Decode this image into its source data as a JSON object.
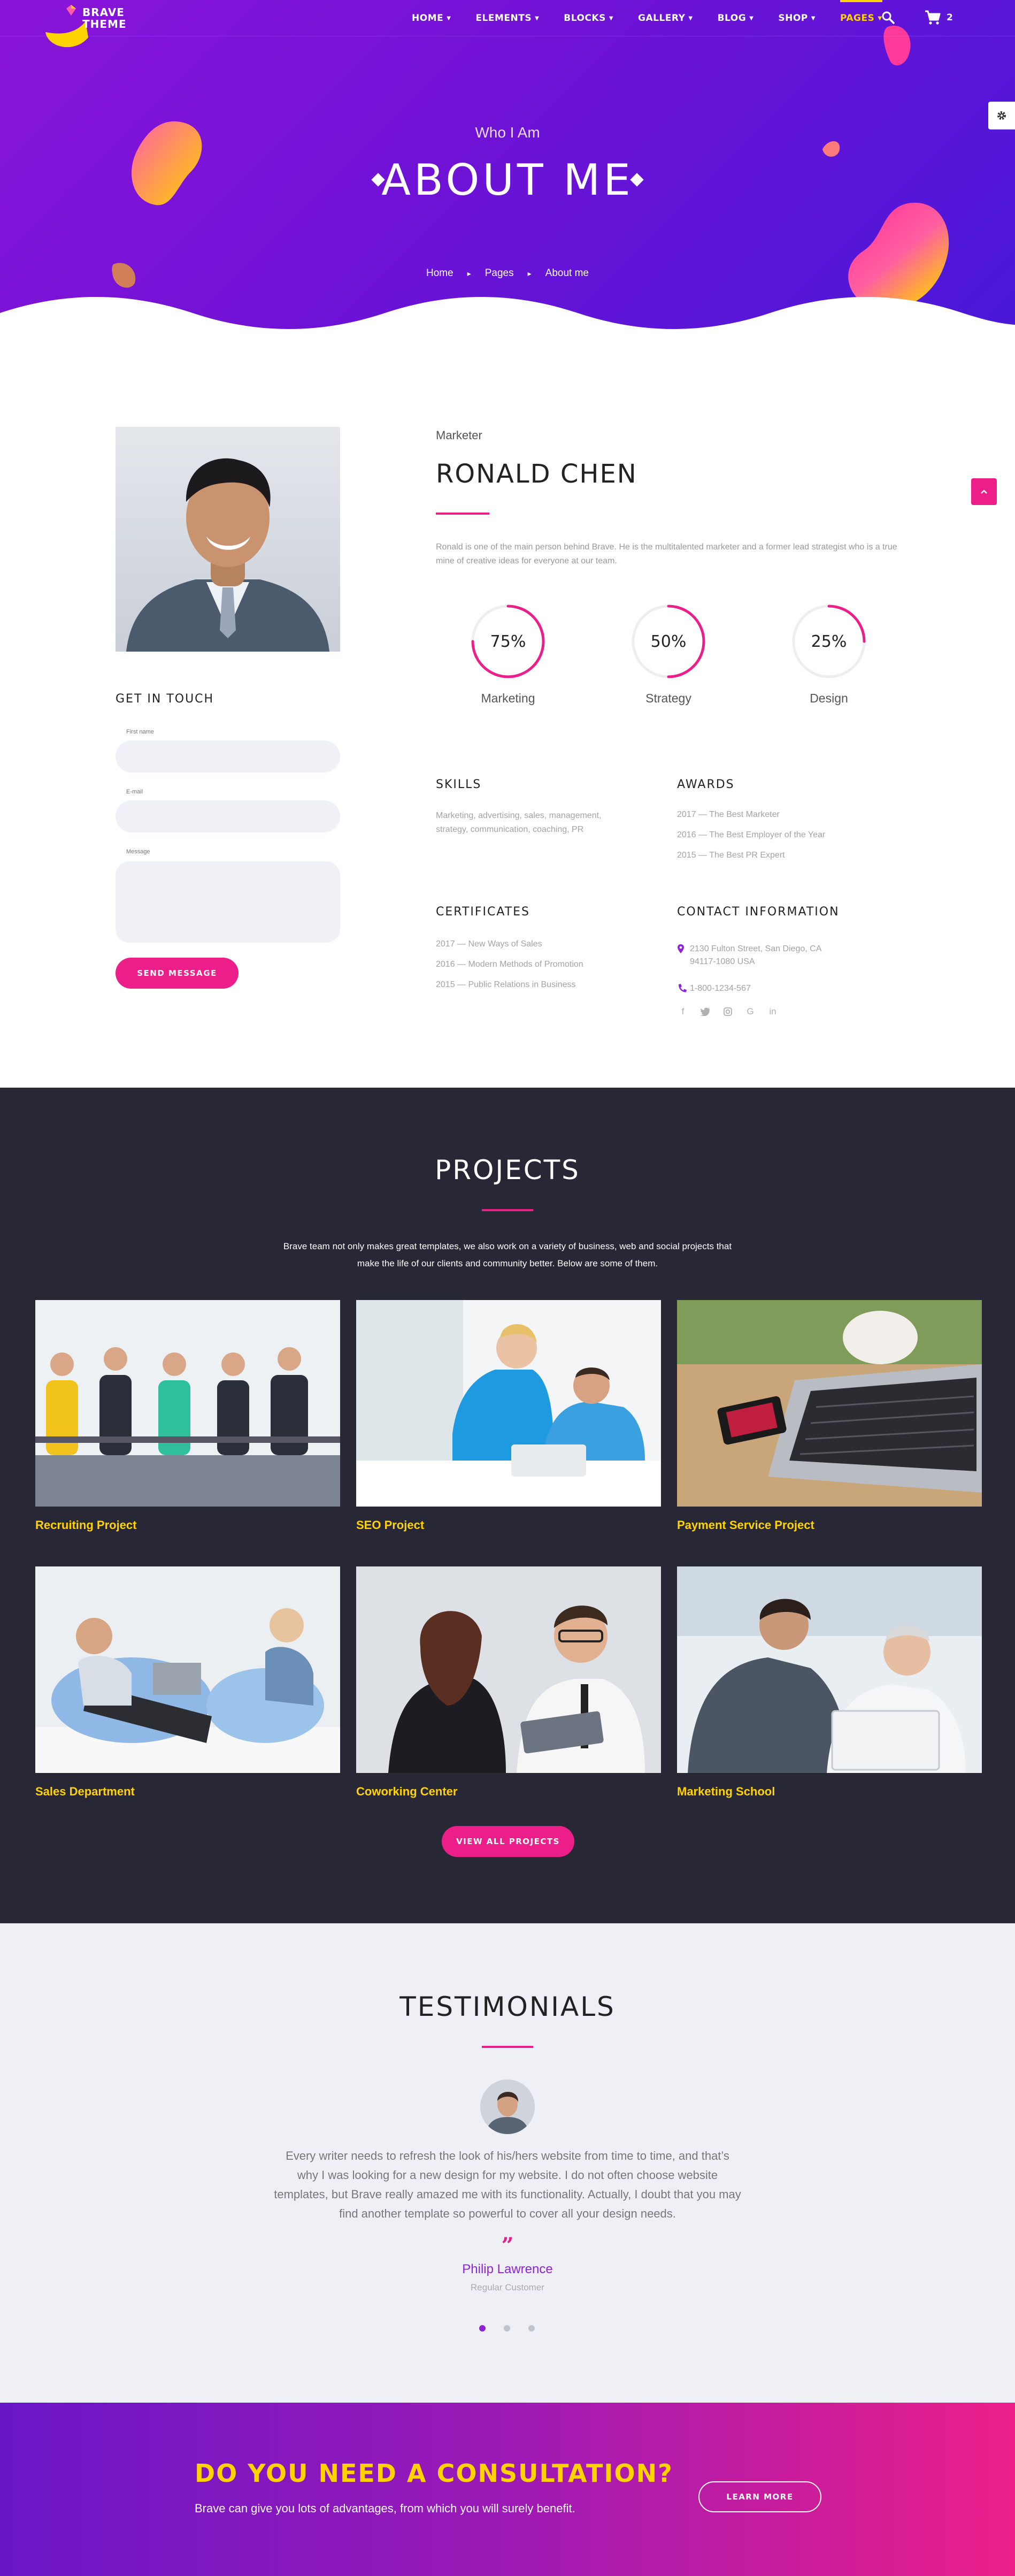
{
  "brand": {
    "logo_line1": "BRAVE",
    "logo_line2": "THEME"
  },
  "nav": {
    "items": [
      {
        "label": "HOME"
      },
      {
        "label": "ELEMENTS"
      },
      {
        "label": "BLOCKS"
      },
      {
        "label": "GALLERY"
      },
      {
        "label": "BLOG"
      },
      {
        "label": "SHOP"
      },
      {
        "label": "PAGES"
      }
    ],
    "active": "PAGES",
    "cart_count": "2",
    "icons": [
      "search-icon",
      "cart-icon",
      "gear-icon"
    ]
  },
  "hero": {
    "subtitle": "Who I Am",
    "title": "ABOUT ME",
    "breadcrumb": [
      "Home",
      "Pages",
      "About me"
    ]
  },
  "profile": {
    "role": "Marketer",
    "name": "RONALD CHEN",
    "bio": "Ronald is one of the main person behind Brave. He is the multitalented marketer and a former lead strategist who is a true mine of creative ideas for everyone at our team.",
    "stats": [
      {
        "value": "75%",
        "percent": 75,
        "label": "Marketing"
      },
      {
        "value": "50%",
        "percent": 50,
        "label": "Strategy"
      },
      {
        "value": "25%",
        "percent": 25,
        "label": "Design"
      }
    ],
    "skills_title": "SKILLS",
    "skills_text": "Marketing, advertising, sales, management, strategy, communication, coaching, PR",
    "awards_title": "AWARDS",
    "awards": [
      "2017 — The Best Marketer",
      "2016 — The Best Employer of the Year",
      "2015 — The Best PR Expert"
    ],
    "certificates_title": "CERTIFICATES",
    "certificates": [
      "2017 — New Ways of Sales",
      "2016 — Modern Methods of Promotion",
      "2015 — Public Relations in Business"
    ],
    "contact_title": "CONTACT INFORMATION",
    "address_line1": "2130 Fulton Street, San Diego, CA",
    "address_line2": "94117-1080 USA",
    "phone": "1-800-1234-567",
    "social_icons": [
      "facebook-icon",
      "twitter-icon",
      "instagram-icon",
      "google-icon",
      "linkedin-icon"
    ]
  },
  "contact_form": {
    "title": "GET IN TOUCH",
    "first_name_label": "First name",
    "email_label": "E-mail",
    "message_label": "Message",
    "first_name_value": "",
    "email_value": "",
    "message_value": "",
    "submit": "SEND MESSAGE"
  },
  "projects": {
    "title": "PROJECTS",
    "description": "Brave team not only makes great templates, we also work on a variety of business, web and social projects that make the life of our clients and community better. Below are some of them.",
    "items": [
      {
        "caption": "Recruiting Project"
      },
      {
        "caption": "SEO Project"
      },
      {
        "caption": "Payment Service Project"
      },
      {
        "caption": "Sales Department"
      },
      {
        "caption": "Coworking Center"
      },
      {
        "caption": "Marketing School"
      }
    ],
    "button": "VIEW ALL PROJECTS"
  },
  "testimonials": {
    "title": "TESTIMONIALS",
    "quote": "Every writer needs to refresh the look of his/hers website from time to time, and that’s why I was looking for a new design for my website. I do not often choose website templates, but Brave really amazed me with its functionality. Actually, I doubt that you may find another template so powerful to cover all your design needs.",
    "quote_mark": "”",
    "author": "Philip Lawrence",
    "author_role": "Regular Customer",
    "slides": 3,
    "active_slide": 1
  },
  "cta": {
    "title": "DO YOU NEED A CONSULTATION?",
    "text": "Brave can give you lots of advantages, from which you will surely benefit.",
    "button": "LEARN MORE"
  },
  "colors": {
    "accent_pink": "#ec1f8a",
    "accent_yellow": "#ffd200",
    "hero_purple": "#7a14d8",
    "dark_section": "#272736",
    "author_purple": "#8e24d8"
  }
}
